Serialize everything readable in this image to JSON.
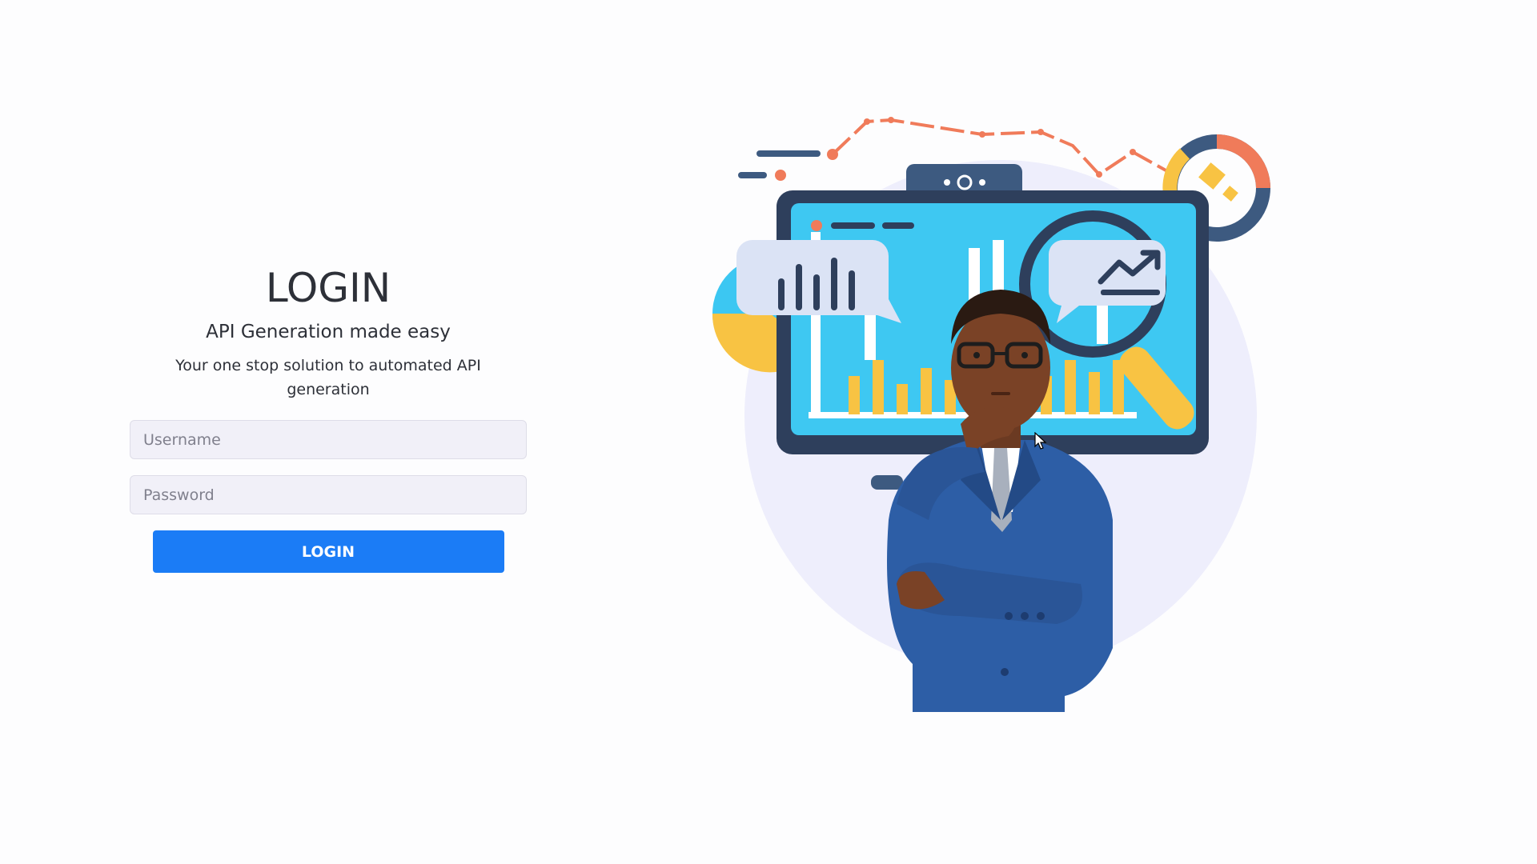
{
  "login": {
    "title": "LOGIN",
    "subtitle": "API Generation made easy",
    "description": "Your one stop solution to automated API generation",
    "username_placeholder": "Username",
    "password_placeholder": "Password",
    "button_label": "LOGIN"
  },
  "illustration": {
    "subject": "business-analyst-thinking",
    "icons": [
      "bar-chart-icon",
      "trend-up-icon",
      "magnifier-icon",
      "pie-chart-icon",
      "donut-chart-icon"
    ]
  },
  "colors": {
    "background": "#fdfdfe",
    "primary_button": "#1b7cf6",
    "input_background": "#f1f0f8",
    "text": "#2d3038"
  }
}
